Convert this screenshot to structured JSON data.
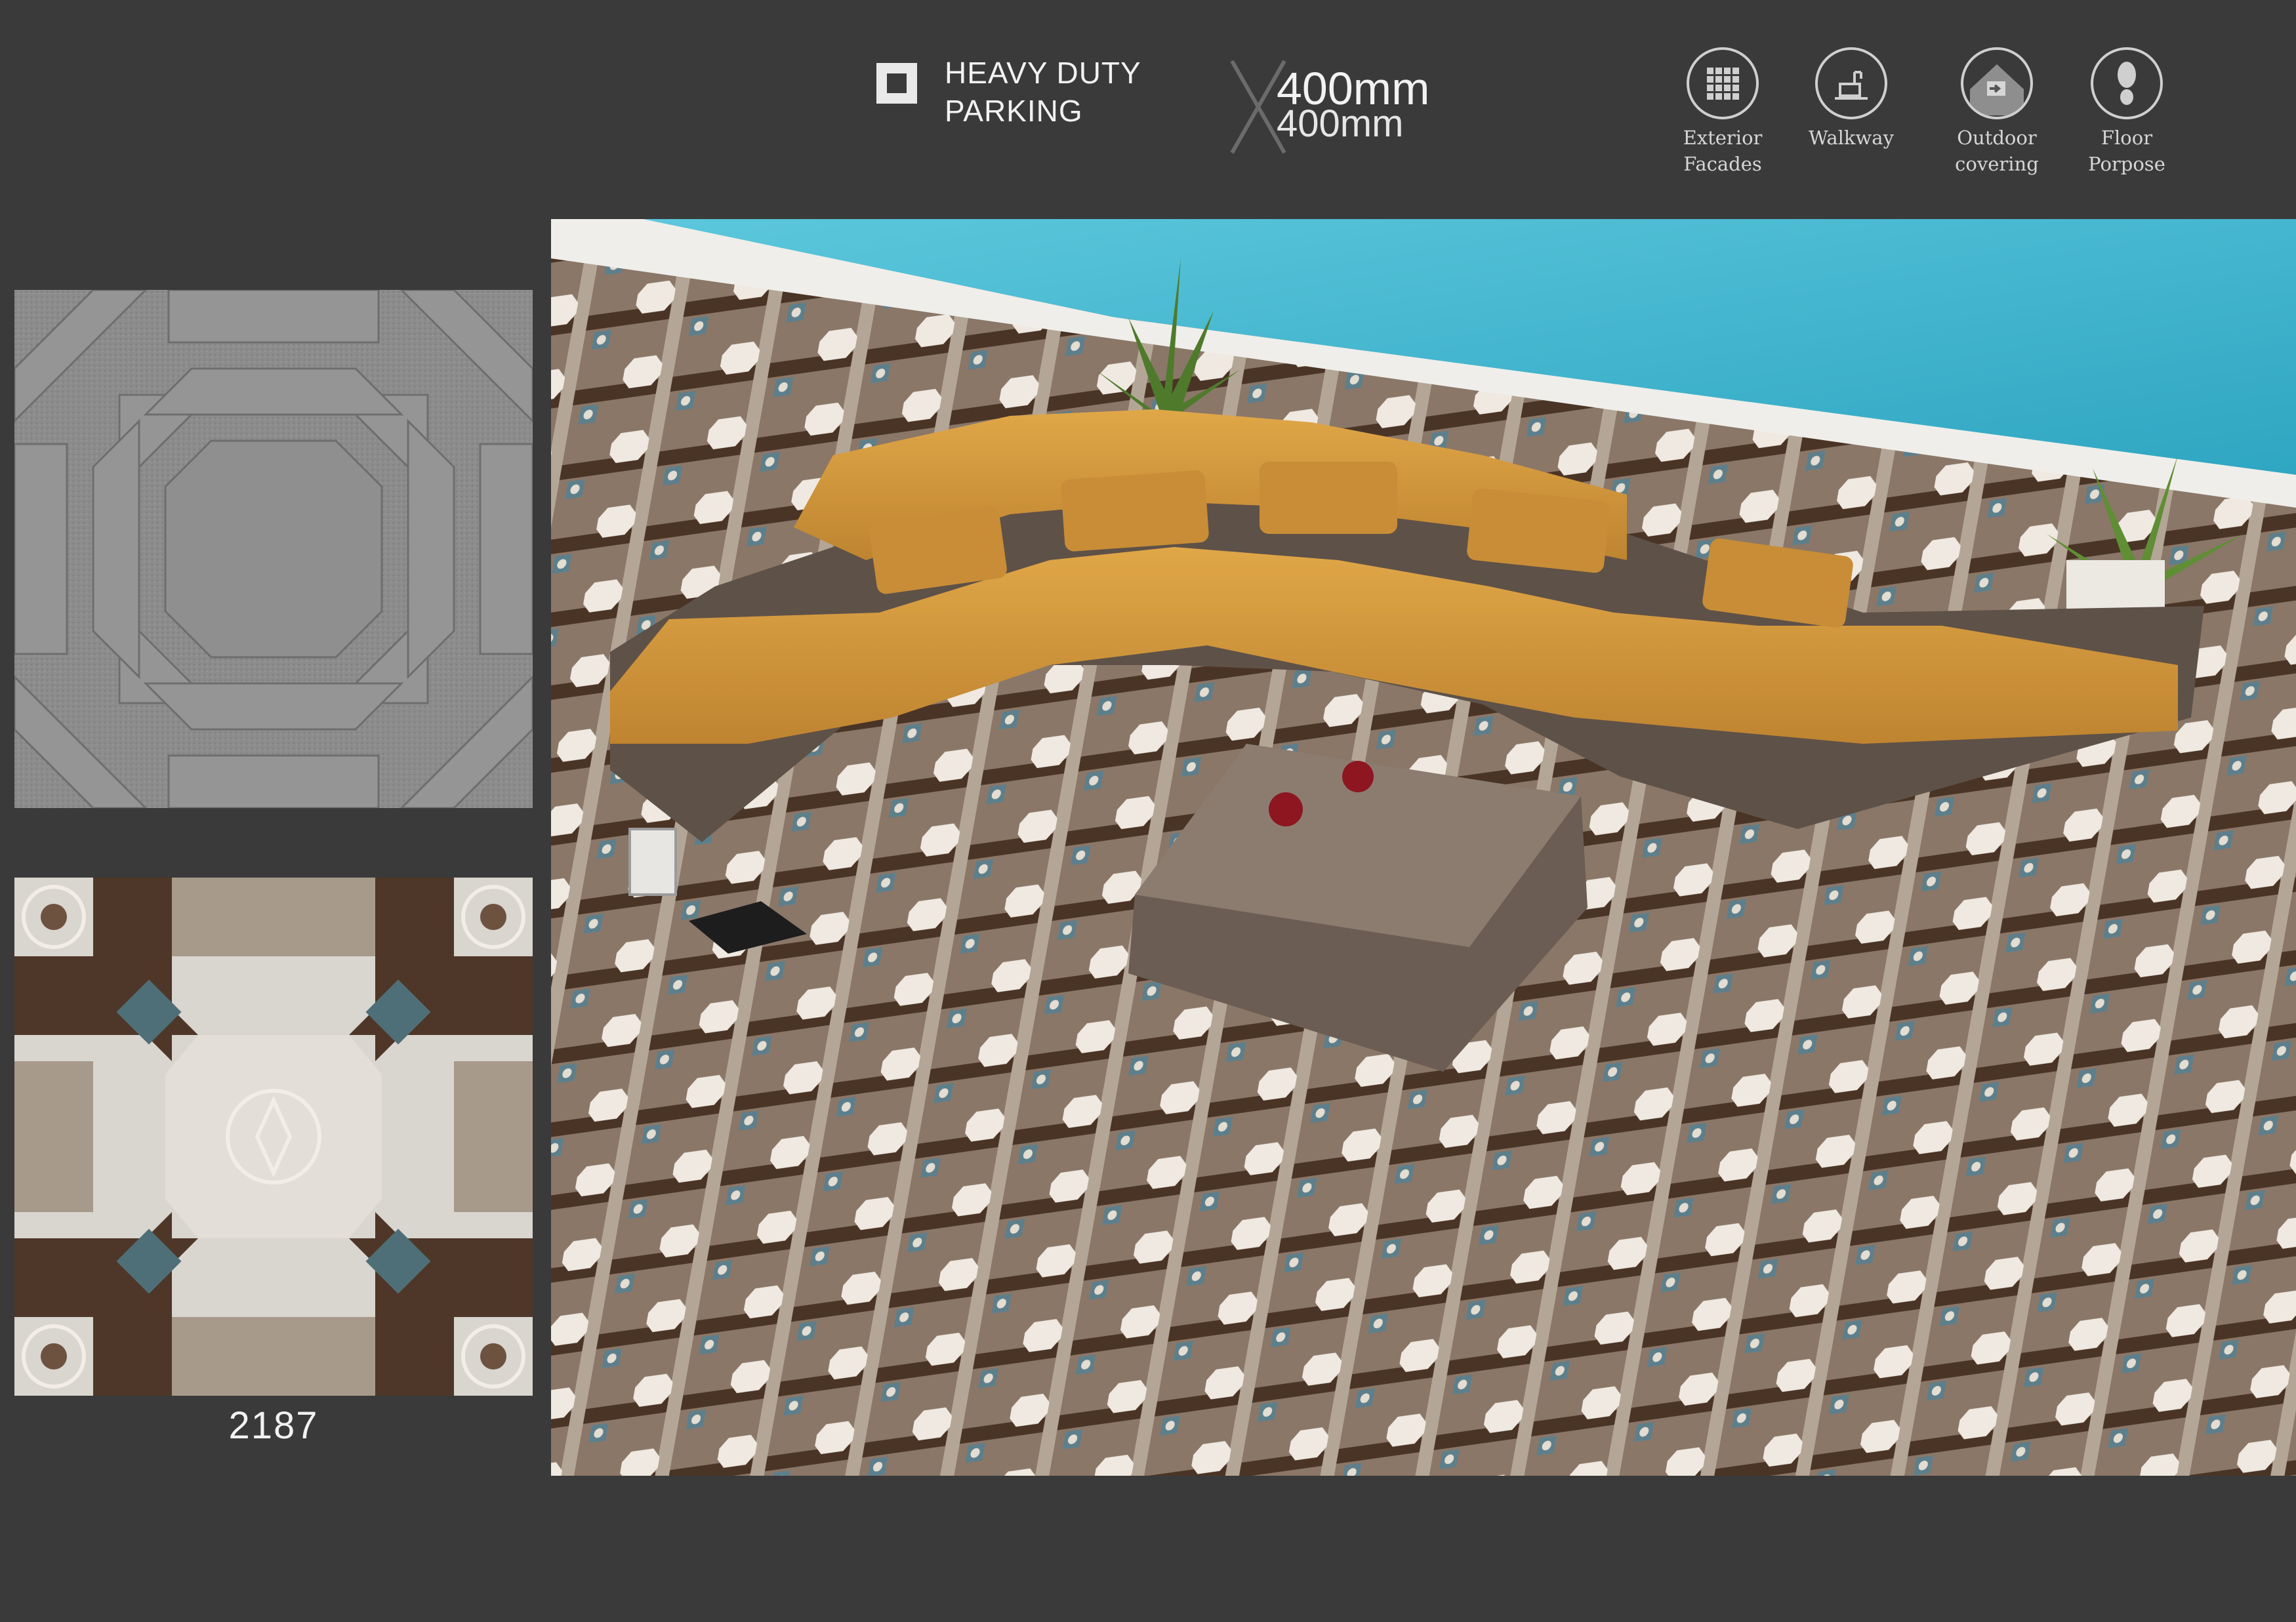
{
  "header": {
    "badge_line1": "HEAVY DUTY",
    "badge_line2": "PARKING",
    "size_line1": "400mm",
    "size_line2": "400mm"
  },
  "usage_icons": [
    {
      "icon": "grid-icon",
      "line1": "Exterior",
      "line2": "Facades"
    },
    {
      "icon": "walkway-icon",
      "line1": "Walkway",
      "line2": ""
    },
    {
      "icon": "house-icon",
      "line1": "Outdoor",
      "line2": "covering"
    },
    {
      "icon": "footprint-icon",
      "line1": "Floor",
      "line2": "Porpose"
    }
  ],
  "tile": {
    "code": "2187"
  },
  "colors": {
    "background": "#3a3a3b",
    "sofa_cushion": "#d39a3a",
    "wicker": "#5e5148",
    "pool": "#3cb7cf",
    "tile_dark": "#4a3426",
    "tile_light": "#efe9e1",
    "tile_accent": "#5d7f8c"
  }
}
